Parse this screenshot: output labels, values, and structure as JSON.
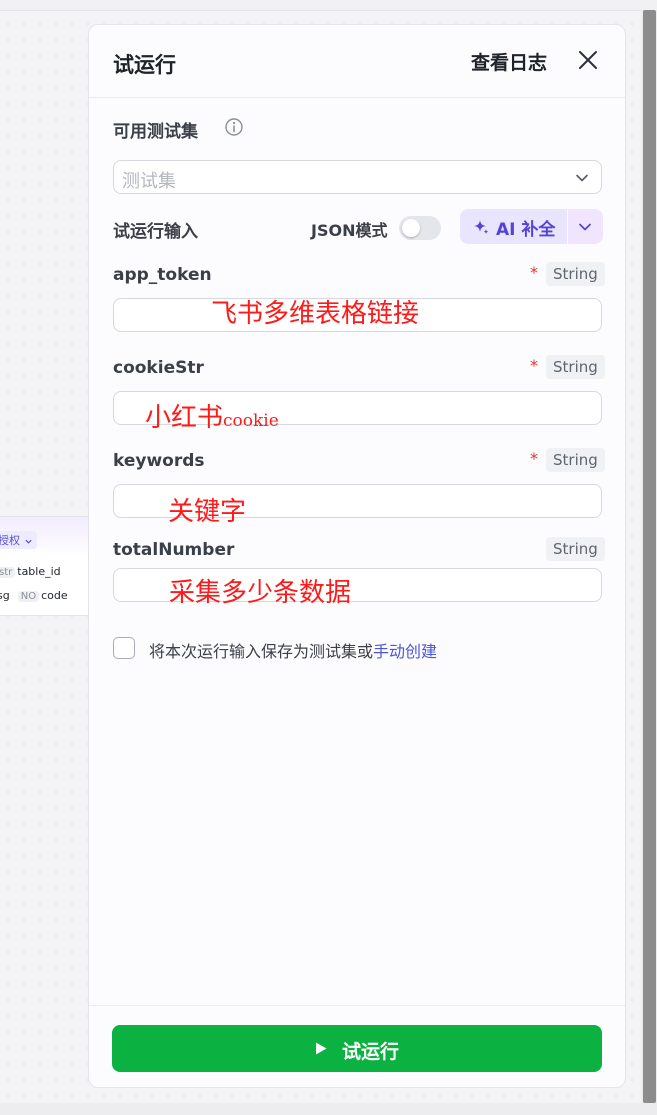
{
  "panel": {
    "title": "试运行",
    "view_log": "查看日志"
  },
  "test_set": {
    "label": "可用测试集",
    "placeholder": "测试集"
  },
  "run_input": {
    "label": "试运行输入",
    "json_mode_label": "JSON模式",
    "json_mode_on": false,
    "ai_button_label": "AI 补全"
  },
  "fields": [
    {
      "name": "app_token",
      "required": true,
      "type": "String",
      "annotation": "飞书多维表格链接"
    },
    {
      "name": "cookieStr",
      "required": true,
      "type": "String",
      "annotation_main": "小红书",
      "annotation_small": "cookie"
    },
    {
      "name": "keywords",
      "required": true,
      "type": "String",
      "annotation": "关键字"
    },
    {
      "name": "totalNumber",
      "required": false,
      "type": "String",
      "annotation": "采集多少条数据"
    }
  ],
  "required_mark": "*",
  "save_option": {
    "text": "将本次运行输入保存为测试集或",
    "link": "手动创建"
  },
  "run_button_label": "试运行",
  "background_node": {
    "auth_chip": "授权",
    "row1_type": "str",
    "row1_name": "table_id",
    "row2_prefix": "sg",
    "row2_type": "NO",
    "row2_name": "code"
  },
  "colors": {
    "accent": "#5443d6",
    "run_button": "#0bb141",
    "required": "#e03131",
    "annotation": "#ff1a1a",
    "link": "#4c55d8"
  }
}
